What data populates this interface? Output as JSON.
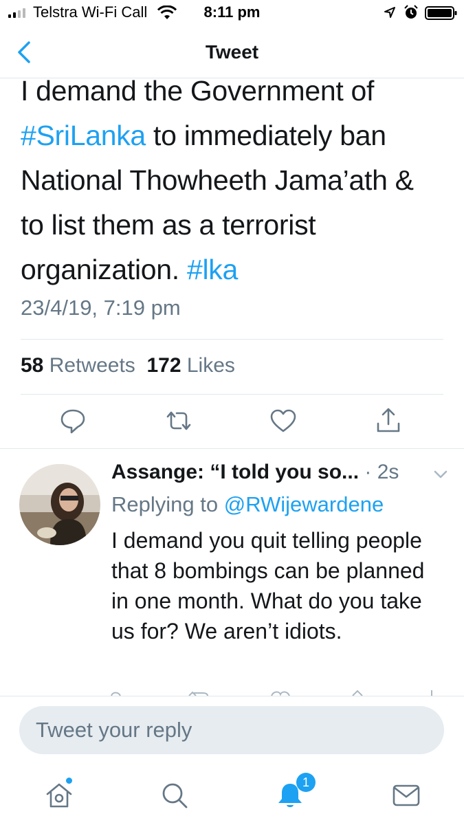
{
  "status_bar": {
    "carrier": "Telstra Wi-Fi Call",
    "time": "8:11 pm"
  },
  "nav": {
    "title": "Tweet"
  },
  "tweet": {
    "line1": "I demand the Government of",
    "hashtag1": "#SriLanka",
    "line2_rest": " to immediately ban",
    "line3": "National Thowheeth Jama’ath &",
    "line4": "to list them as a terrorist",
    "line5": "organization. ",
    "hashtag2": "#lka",
    "timestamp": "23/4/19, 7:19 pm",
    "retweets_count": "58",
    "retweets_label": "Retweets",
    "likes_count": "172",
    "likes_label": "Likes"
  },
  "reply": {
    "name": "Assange: “I told you so...",
    "time": " · 2s",
    "replying_prefix": "Replying to ",
    "replying_handle": "@RWijewardene",
    "text": "I demand you quit telling people that 8 bombings can be planned in one month. What do you take us for? We aren’t idiots."
  },
  "composer": {
    "placeholder": "Tweet your reply"
  },
  "tabbar": {
    "notifications_badge": "1"
  },
  "colors": {
    "accent": "#1da1f2",
    "secondary_text": "#657786",
    "primary_text": "#14171a",
    "divider": "#e1e8ed"
  },
  "icons": [
    "back-chevron-icon",
    "reply-icon",
    "retweet-icon",
    "like-icon",
    "share-icon",
    "chevron-down-icon",
    "home-icon",
    "search-icon",
    "notifications-icon",
    "messages-icon"
  ]
}
